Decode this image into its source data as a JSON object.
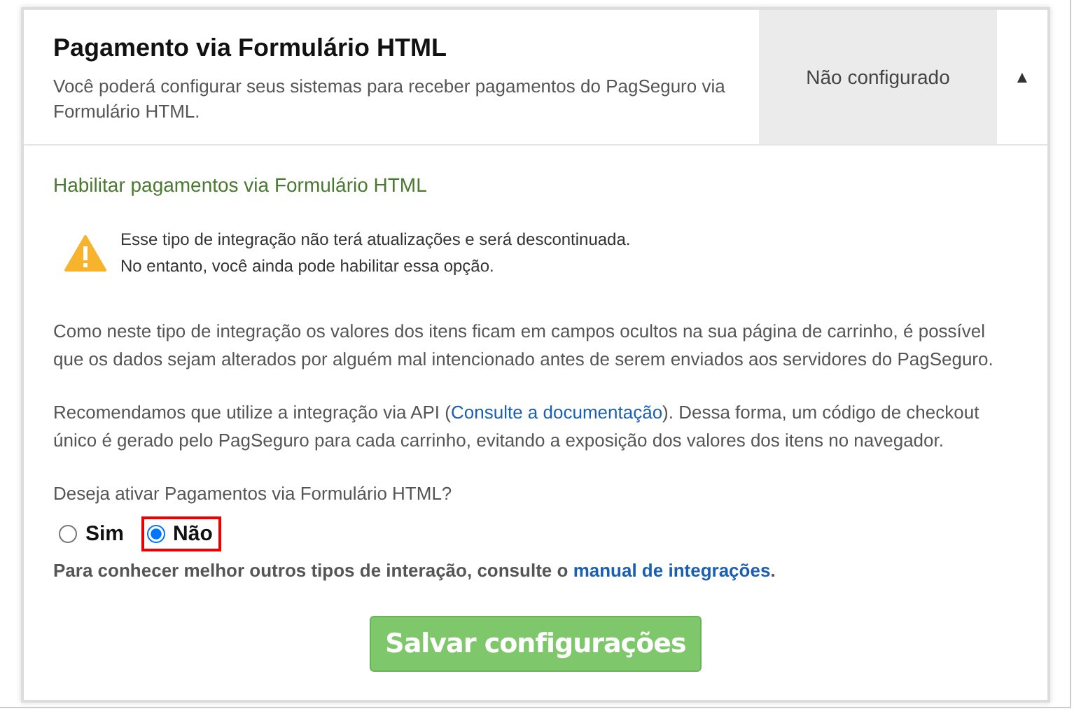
{
  "header": {
    "title": "Pagamento via Formulário HTML",
    "description": "Você poderá configurar seus sistemas para receber pagamentos do PagSeguro via Formulário HTML.",
    "status": "Não configurado",
    "toggle": "▲",
    "expanded": true
  },
  "section_title": "Habilitar pagamentos via Formulário HTML",
  "warning": {
    "lines": [
      "Esse tipo de integração não terá atualizações e será descontinuada.",
      "No entanto, você ainda pode habilitar essa opção."
    ]
  },
  "paragraphs": [
    {
      "before": "Como neste tipo de integração os valores dos itens ficam em campos ocultos na sua página de carrinho, é possível que os dados sejam alterados por alguém mal intencionado antes de serem enviados aos servidores do PagSeguro."
    },
    {
      "before": "Recomendamos que utilize a integração via API (",
      "link": "Consulte a documentação",
      "after": "). Dessa forma, um código de checkout único é gerado pelo PagSeguro para cada carrinho, evitando a exposição dos valores dos itens no navegador."
    }
  ],
  "question": "Deseja ativar Pagamentos via Formulário HTML?",
  "options": [
    {
      "label": "Sim",
      "selected": false,
      "highlighted": false
    },
    {
      "label": "Não",
      "selected": true,
      "highlighted": true
    }
  ],
  "hint": {
    "before": "Para conhecer melhor outros tipos de interação, consulte o ",
    "link": "manual de integrações",
    "after": "."
  },
  "save_button": "Salvar configurações"
}
